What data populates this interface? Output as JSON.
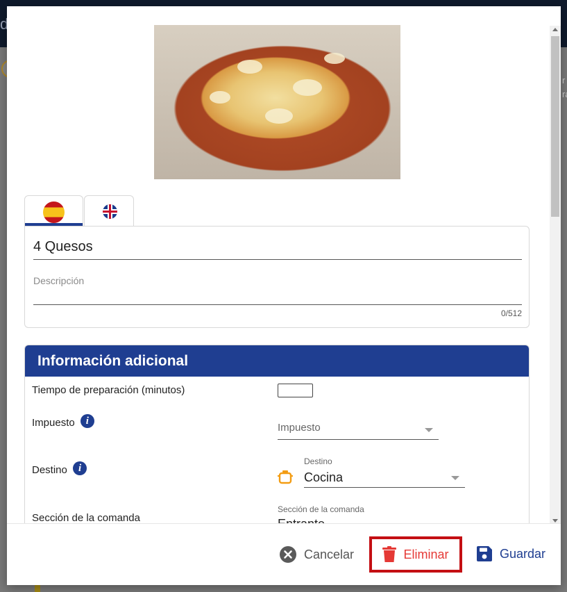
{
  "background": {
    "topbar_fragment": "d",
    "right_fragment_lines": [
      "r",
      "ra"
    ]
  },
  "modal": {
    "image": {
      "alt": "Pizza 4 Quesos"
    },
    "language_tabs": [
      {
        "code": "es",
        "icon": "spain-flag-icon",
        "active": true
      },
      {
        "code": "en",
        "icon": "uk-flag-icon",
        "active": false
      }
    ],
    "product": {
      "name": "4 Quesos",
      "description_placeholder": "Descripción",
      "description": "",
      "char_counter": "0/512"
    },
    "additional_info": {
      "title": "Información adicional",
      "prep_time_label": "Tiempo de preparación (minutos)",
      "prep_time_value": "",
      "tax_label": "Impuesto",
      "tax_placeholder": "Impuesto",
      "destination_label": "Destino",
      "destination_float": "Destino",
      "destination_value": "Cocina",
      "section_label": "Sección de la comanda",
      "section_float": "Sección de la comanda",
      "section_value": "Entrante"
    },
    "footer": {
      "cancel_label": "Cancelar",
      "delete_label": "Eliminar",
      "save_label": "Guardar"
    },
    "colors": {
      "primary": "#1f3e91",
      "danger": "#e53935",
      "highlight_border": "#c40f13",
      "destination_icon": "#f39c12"
    }
  }
}
